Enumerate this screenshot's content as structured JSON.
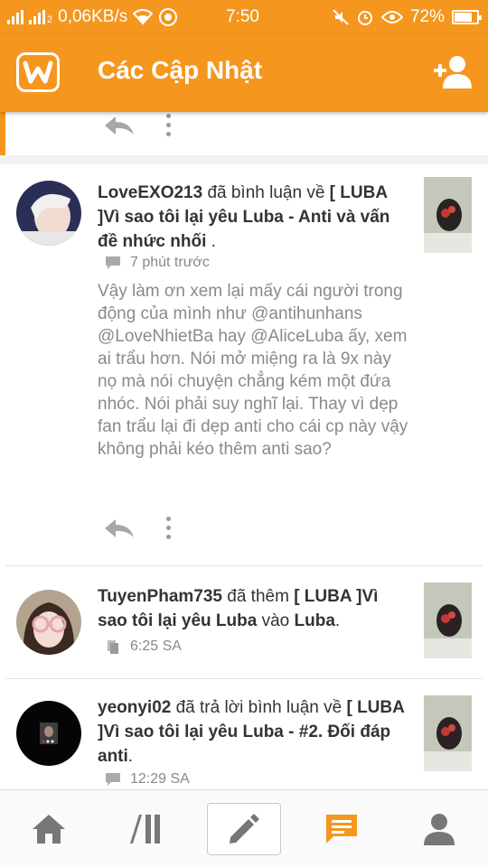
{
  "status_bar": {
    "network_type": "2",
    "speed": "0,06KB/s",
    "time": "7:50",
    "battery": "72%",
    "battery_level": 0.72
  },
  "app_bar": {
    "title": "Các Cập Nhật",
    "logo_letter": "W"
  },
  "colors": {
    "accent": "#f5961e",
    "text_dark": "#333333",
    "text_muted": "#888888"
  },
  "feed": {
    "items": [
      {
        "user": "LoveEXO213",
        "action": " đã bình luận về ",
        "story": "[ LUBA ]Vì sao tôi lại yêu Luba - Anti và vấn đề nhức nhối",
        "suffix": " .",
        "meta_icon": "comment-icon",
        "time": "7 phút trước",
        "body": "Vậy làm ơn xem lại mấy cái người trong động của mình như @antihunhans  @LoveNhietBa hay @AliceLuba ấy, xem ai trẩu hơn. Nói mở miệng ra là 9x này nọ mà nói chuyện chẳng kém một đứa nhóc. Nói phải suy nghĩ lại. Thay vì dẹp fan trẩu lại đi dẹp anti cho cái cp này vậy không phải kéo thêm anti sao?"
      },
      {
        "user": "TuyenPham735",
        "action": " đã thêm ",
        "story": "[ LUBA ]Vì sao tôi lại yêu Luba",
        "mid": " vào ",
        "target": "Luba",
        "suffix": ".",
        "meta_icon": "library-icon",
        "time": "6:25 SA"
      },
      {
        "user": "yeonyi02",
        "action": " đã trả lời bình luận về ",
        "story": "[ LUBA ]Vì sao tôi lại yêu Luba - #2. Đối đáp anti",
        "suffix": ".",
        "meta_icon": "comment-icon",
        "time": "12:29 SA"
      }
    ]
  },
  "bottom_nav": [
    "home-icon",
    "library-icon",
    "write-icon",
    "updates-icon",
    "profile-icon"
  ]
}
